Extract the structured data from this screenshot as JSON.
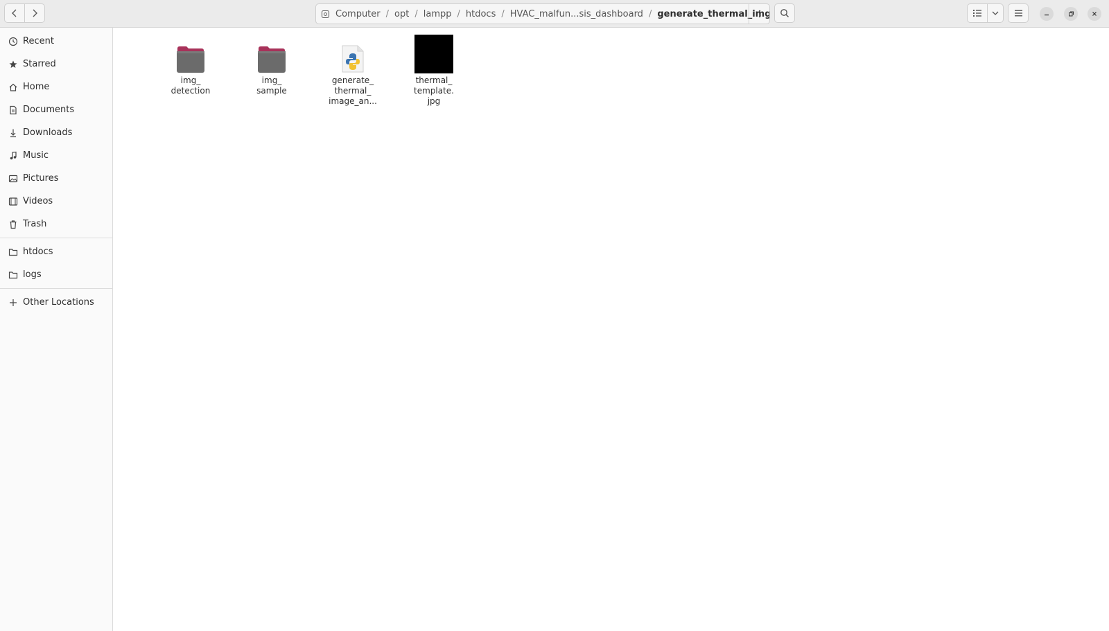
{
  "path": {
    "root_icon": "disk-icon",
    "crumbs": [
      "Computer",
      "opt",
      "lampp",
      "htdocs",
      "HVAC_malfun...sis_dashboard",
      "generate_thermal_img"
    ]
  },
  "sidebar": {
    "places": [
      {
        "label": "Recent",
        "icon": "clock-icon"
      },
      {
        "label": "Starred",
        "icon": "star-icon"
      },
      {
        "label": "Home",
        "icon": "home-icon"
      },
      {
        "label": "Documents",
        "icon": "document-icon"
      },
      {
        "label": "Downloads",
        "icon": "download-icon"
      },
      {
        "label": "Music",
        "icon": "music-icon"
      },
      {
        "label": "Pictures",
        "icon": "picture-icon"
      },
      {
        "label": "Videos",
        "icon": "video-icon"
      },
      {
        "label": "Trash",
        "icon": "trash-icon"
      }
    ],
    "bookmarks": [
      {
        "label": "htdocs",
        "icon": "folder-icon"
      },
      {
        "label": "logs",
        "icon": "folder-icon"
      }
    ],
    "other": {
      "label": "Other Locations",
      "icon": "plus-icon"
    }
  },
  "files": [
    {
      "line1": "img_",
      "line2": "detection",
      "line3": "",
      "type": "folder"
    },
    {
      "line1": "img_",
      "line2": "sample",
      "line3": "",
      "type": "folder"
    },
    {
      "line1": "generate_",
      "line2": "thermal_",
      "line3": "image_an...",
      "type": "python"
    },
    {
      "line1": "thermal_",
      "line2": "template.",
      "line3": "jpg",
      "type": "image"
    }
  ],
  "colors": {
    "folder_tab": "#a8325a",
    "folder_body": "#6b6b6b",
    "thumbnail": "#000000"
  }
}
